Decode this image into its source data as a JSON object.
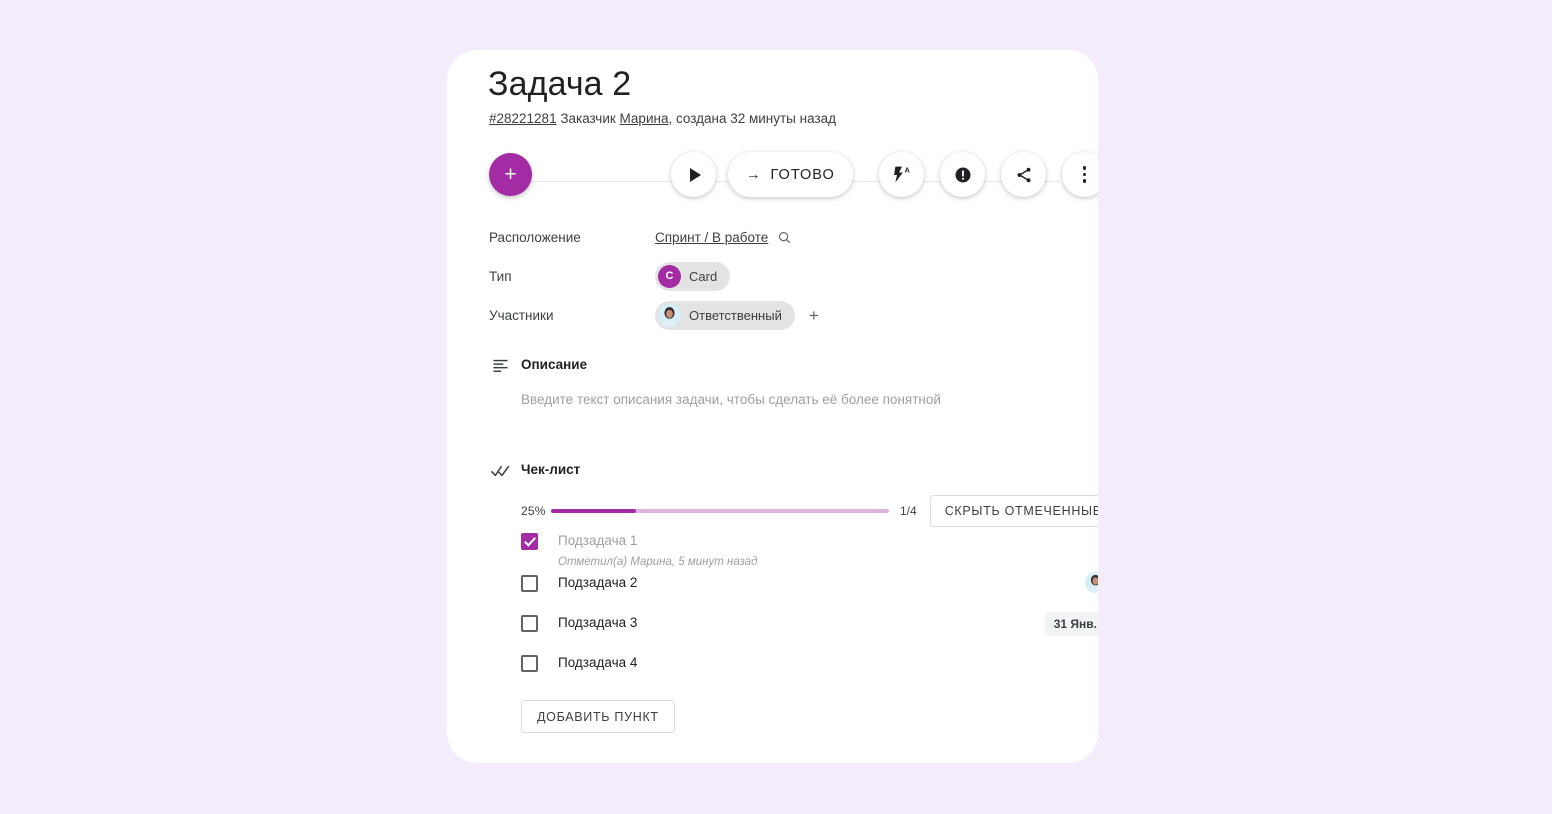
{
  "page": {
    "background_color": "#f4ecfb",
    "accent_color": "#a32ba3"
  },
  "task": {
    "title": "Задача 2",
    "id_link": "#28221281",
    "meta_prefix": " Заказчик ",
    "author": "Марина",
    "meta_suffix": ", создана 32 минуты назад"
  },
  "toolbar": {
    "add_label": "+",
    "status_label": "ГОТОВО",
    "status_arrow": "→",
    "icons": {
      "play": "play-icon",
      "flash_auto": "flash-auto-icon",
      "priority": "exclamation-circle-icon",
      "share": "share-icon",
      "more": "more-vertical-icon"
    }
  },
  "properties": [
    {
      "label": "Расположение",
      "value": "Спринт / В работе",
      "type": "link",
      "icon": "search-icon"
    },
    {
      "label": "Тип",
      "value": "Card",
      "type": "chip",
      "badge": "C"
    },
    {
      "label": "Участники",
      "value": "Ответственный",
      "type": "avatar-chip",
      "add_label": "+"
    }
  ],
  "description": {
    "icon": "align-left-icon",
    "title": "Описание",
    "placeholder": "Введите текст описания задачи, чтобы сделать её более понятной"
  },
  "checklist": {
    "icon": "double-check-icon",
    "title": "Чек-лист",
    "percent_label": "25%",
    "percent_value": 25,
    "ratio_label": "1/4",
    "hide_checked_label": "СКРЫТЬ ОТМЕЧЕННЫЕ",
    "add_item_label": "ДОБАВИТЬ ПУНКТ",
    "items": [
      {
        "label": "Подзадача 1",
        "checked": true,
        "meta": "Отметил(а) Марина, 5 минут назад",
        "right": "none"
      },
      {
        "label": "Подзадача 2",
        "checked": false,
        "meta": "",
        "right": "avatar"
      },
      {
        "label": "Подзадача 3",
        "checked": false,
        "meta": "",
        "right": "date",
        "date": "31 Янв."
      },
      {
        "label": "Подзадача 4",
        "checked": false,
        "meta": "",
        "right": "none"
      }
    ]
  }
}
